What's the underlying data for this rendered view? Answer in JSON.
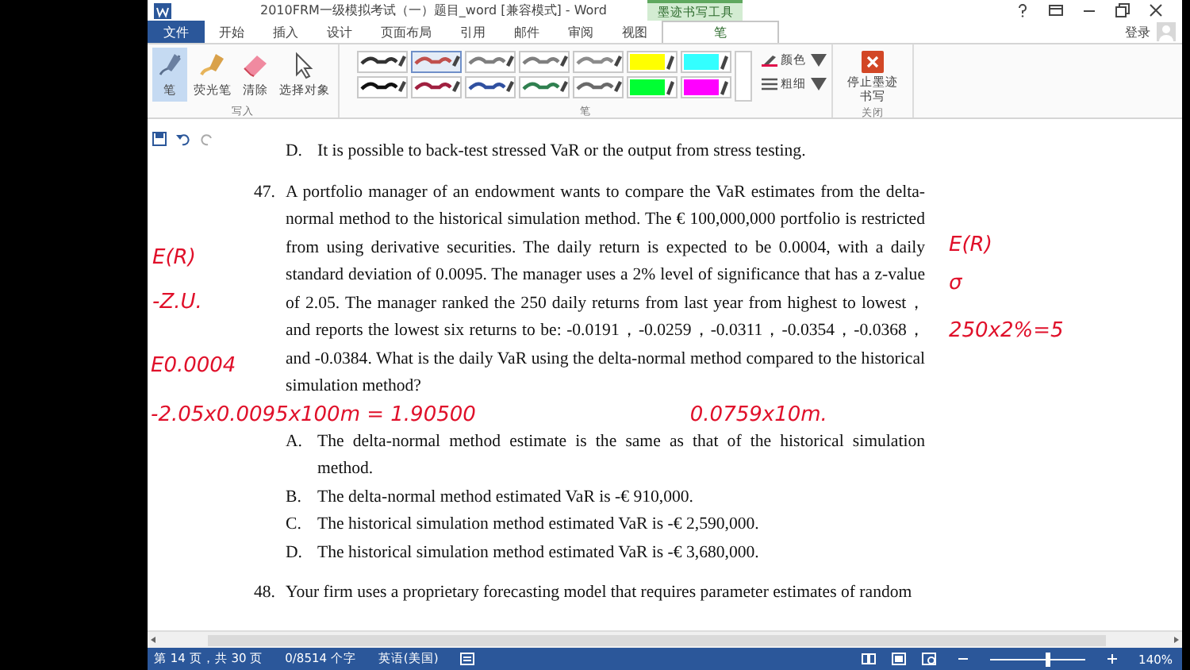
{
  "window": {
    "title": "2010FRM一级模拟考试（一）题目_word [兼容模式] - Word",
    "contextual_tab": "墨迹书写工具"
  },
  "tabs": [
    {
      "label": "文件",
      "kind": "file",
      "selected": false
    },
    {
      "label": "开始",
      "kind": "normal",
      "selected": false
    },
    {
      "label": "插入",
      "kind": "normal",
      "selected": false
    },
    {
      "label": "设计",
      "kind": "normal",
      "selected": false
    },
    {
      "label": "页面布局",
      "kind": "normal",
      "selected": false
    },
    {
      "label": "引用",
      "kind": "normal",
      "selected": false
    },
    {
      "label": "邮件",
      "kind": "normal",
      "selected": false
    },
    {
      "label": "审阅",
      "kind": "normal",
      "selected": false
    },
    {
      "label": "视图",
      "kind": "normal",
      "selected": false
    },
    {
      "label": "笔",
      "kind": "contextual",
      "selected": true
    }
  ],
  "account": {
    "label": "登录"
  },
  "write_group": {
    "label": "写入",
    "tools": [
      {
        "label": "笔",
        "kind": "pen",
        "selected": true
      },
      {
        "label": "荧光笔",
        "kind": "highlighter",
        "selected": false
      },
      {
        "label": "清除",
        "kind": "eraser",
        "selected": false
      },
      {
        "label": "选择对象",
        "kind": "select",
        "selected": false
      }
    ]
  },
  "pens_group": {
    "label": "笔",
    "pens": [
      {
        "kind": "pen",
        "color": "#333333",
        "selected": false
      },
      {
        "kind": "pen",
        "color": "#c0504d",
        "selected": true
      },
      {
        "kind": "pen",
        "color": "#7f7f7f",
        "selected": false
      },
      {
        "kind": "pen",
        "color": "#7f7f7f",
        "selected": false
      },
      {
        "kind": "pen",
        "color": "#8c8c8c",
        "selected": false
      },
      {
        "kind": "highlighter",
        "color": "#ffff00",
        "selected": false
      },
      {
        "kind": "highlighter",
        "color": "#33ffff",
        "selected": false
      },
      {
        "kind": "pen",
        "color": "#111111",
        "selected": false
      },
      {
        "kind": "pen",
        "color": "#a02040",
        "selected": false
      },
      {
        "kind": "pen",
        "color": "#3050a0",
        "selected": false
      },
      {
        "kind": "pen",
        "color": "#308050",
        "selected": false
      },
      {
        "kind": "pen",
        "color": "#6a6a6a",
        "selected": false
      },
      {
        "kind": "highlighter",
        "color": "#00ff33",
        "selected": false
      },
      {
        "kind": "highlighter",
        "color": "#ff00ff",
        "selected": false
      }
    ],
    "options": [
      "颜色",
      "粗细"
    ]
  },
  "close_group": {
    "label": "关闭",
    "button": "停止墨迹书写"
  },
  "document": {
    "items": [
      {
        "kind": "option",
        "marker": "D.",
        "text": "It is possible to back-test stressed VaR or the output from stress testing."
      },
      {
        "kind": "question",
        "marker": "47.",
        "text": "A portfolio manager of an endowment wants to compare the VaR estimates from the delta-normal method to the historical simulation method. The € 100,000,000 portfolio is restricted from using derivative securities. The daily return is expected to be 0.0004, with a daily standard deviation of 0.0095. The manager uses a 2% level of significance that has a z-value of 2.05. The manager ranked the 250 daily returns from last year from highest to lowest，and reports the lowest six returns to be: -0.0191，-0.0259，-0.0311，-0.0354，-0.0368，and -0.0384. What is the daily VaR using the delta-normal method compared to the historical simulation method?"
      },
      {
        "kind": "option",
        "marker": "A.",
        "text": "The delta-normal method estimate is the same as that of the historical simulation method."
      },
      {
        "kind": "option",
        "marker": "B.",
        "text": "The delta-normal method estimated VaR is -€ 910,000."
      },
      {
        "kind": "option",
        "marker": "C.",
        "text": "The historical simulation method estimated VaR is -€ 2,590,000."
      },
      {
        "kind": "option",
        "marker": "D.",
        "text": "The historical simulation method estimated VaR is -€ 3,680,000."
      },
      {
        "kind": "question",
        "marker": "48.",
        "text": "Your firm uses a proprietary forecasting model that requires parameter estimates of random"
      }
    ],
    "annotations": [
      {
        "text": "E(R)"
      },
      {
        "text": "-Z.U."
      },
      {
        "text": "E0.0004"
      },
      {
        "text": "E(R)"
      },
      {
        "text": "σ"
      },
      {
        "text": "250x2%=5"
      }
    ],
    "calculations": [
      {
        "text": "-2.05x0.0095x100m = 1.90500"
      },
      {
        "text": "0.0759x10m."
      }
    ]
  },
  "status_bar": {
    "page": "第 14 页，共 30 页",
    "words": "0/8514 个字",
    "language": "英语(美国)",
    "zoom_slider": {
      "level": 0.6
    },
    "zoom": "140%"
  }
}
